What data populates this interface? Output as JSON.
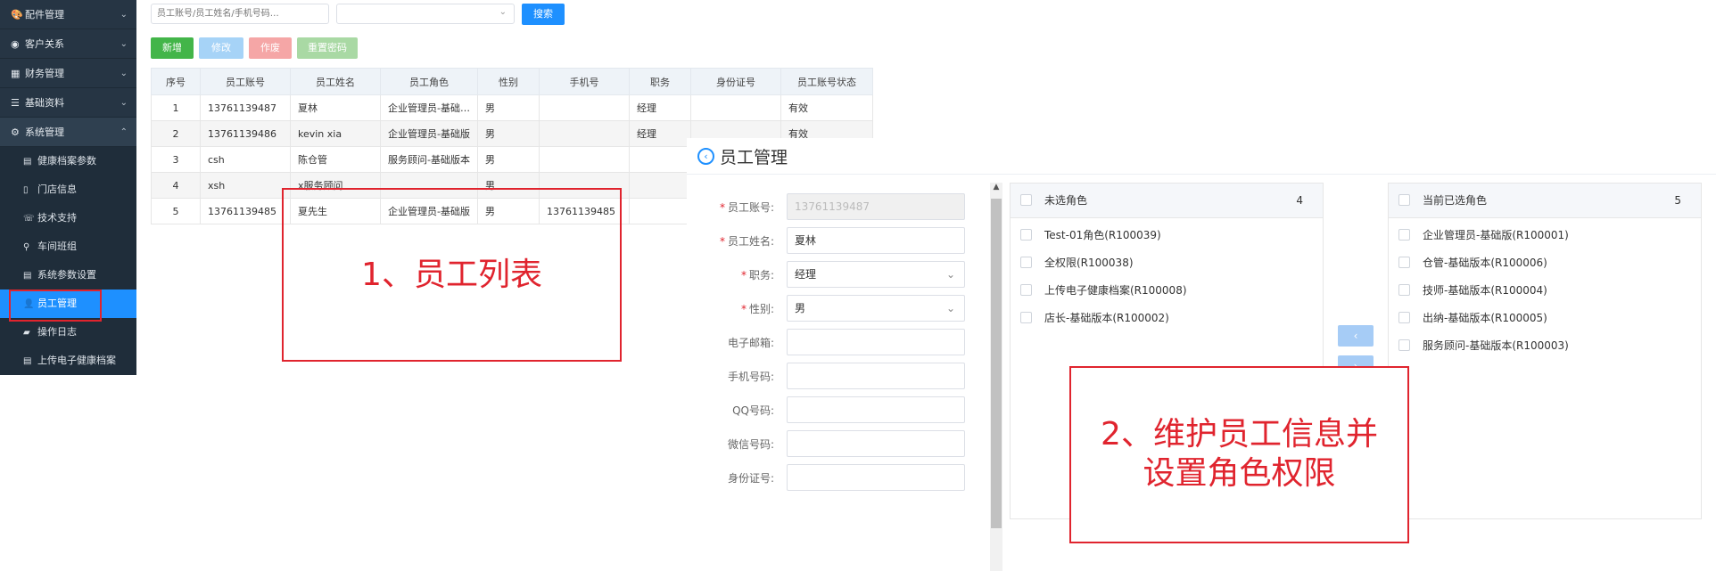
{
  "sidebar": {
    "groups": [
      {
        "label": "配件管理",
        "icon": "palette-icon",
        "glyph": "🎨",
        "chevron": "⌄"
      },
      {
        "label": "客户关系",
        "icon": "user-circle-icon",
        "glyph": "◉",
        "chevron": "⌄"
      },
      {
        "label": "财务管理",
        "icon": "calculator-icon",
        "glyph": "▦",
        "chevron": "⌄"
      },
      {
        "label": "基础资料",
        "icon": "database-icon",
        "glyph": "☰",
        "chevron": "⌄"
      },
      {
        "label": "系统管理",
        "icon": "gears-icon",
        "glyph": "⚙",
        "chevron": "⌃"
      }
    ],
    "sub_items": [
      {
        "label": "健康档案参数",
        "icon": "file-icon",
        "glyph": "▤"
      },
      {
        "label": "门店信息",
        "icon": "file-text-icon",
        "glyph": "▯"
      },
      {
        "label": "技术支持",
        "icon": "phone-icon",
        "glyph": "☏"
      },
      {
        "label": "车间班组",
        "icon": "person-icon",
        "glyph": "⚲"
      },
      {
        "label": "系统参数设置",
        "icon": "file-icon",
        "glyph": "▤"
      },
      {
        "label": "员工管理",
        "icon": "user-plus-icon",
        "glyph": "👤"
      },
      {
        "label": "操作日志",
        "icon": "book-icon",
        "glyph": "▰"
      },
      {
        "label": "上传电子健康档案",
        "icon": "file-icon",
        "glyph": "▤"
      }
    ]
  },
  "list": {
    "search_placeholder": "员工账号/员工姓名/手机号码…",
    "search_button": "搜索",
    "buttons": {
      "add": "新增",
      "edit": "修改",
      "void": "作废",
      "reset": "重置密码"
    },
    "columns": [
      "序号",
      "员工账号",
      "员工姓名",
      "员工角色",
      "性别",
      "手机号",
      "职务",
      "身份证号",
      "员工账号状态"
    ],
    "rows": [
      [
        "1",
        "13761139487",
        "夏林",
        "企业管理员-基础…",
        "男",
        "",
        "经理",
        "",
        "有效"
      ],
      [
        "2",
        "13761139486",
        "kevin xia",
        "企业管理员-基础版",
        "男",
        "",
        "经理",
        "",
        "有效"
      ],
      [
        "3",
        "csh",
        "陈仓管",
        "服务顾问-基础版本",
        "男",
        "",
        "",
        "",
        ""
      ],
      [
        "4",
        "xsh",
        "x服务顾问",
        "",
        "男",
        "",
        "",
        "",
        ""
      ],
      [
        "5",
        "13761139485",
        "夏先生",
        "企业管理员-基础版",
        "男",
        "13761139485",
        "",
        "",
        ""
      ]
    ]
  },
  "annotations": {
    "list": "1、员工列表",
    "edit_line1": "2、维护员工信息并",
    "edit_line2": "设置角色权限"
  },
  "edit": {
    "title": "员工管理",
    "fields": [
      {
        "label": "员工账号:",
        "required": true,
        "value": "13761139487",
        "disabled": true,
        "select": false
      },
      {
        "label": "员工姓名:",
        "required": true,
        "value": "夏林",
        "disabled": false,
        "select": false
      },
      {
        "label": "职务:",
        "required": true,
        "value": "经理",
        "disabled": false,
        "select": true
      },
      {
        "label": "性别:",
        "required": true,
        "value": "男",
        "disabled": false,
        "select": true
      },
      {
        "label": "电子邮箱:",
        "required": false,
        "value": "",
        "disabled": false,
        "select": false
      },
      {
        "label": "手机号码:",
        "required": false,
        "value": "",
        "disabled": false,
        "select": false
      },
      {
        "label": "QQ号码:",
        "required": false,
        "value": "",
        "disabled": false,
        "select": false
      },
      {
        "label": "微信号码:",
        "required": false,
        "value": "",
        "disabled": false,
        "select": false
      },
      {
        "label": "身份证号:",
        "required": false,
        "value": "",
        "disabled": false,
        "select": false
      }
    ],
    "unselected": {
      "title": "未选角色",
      "count": "4",
      "items": [
        "Test-01角色(R100039)",
        "全权限(R100038)",
        "上传电子健康档案(R100008)",
        "店长-基础版本(R100002)"
      ]
    },
    "selected": {
      "title": "当前已选角色",
      "count": "5",
      "items": [
        "企业管理员-基础版(R100001)",
        "仓管-基础版本(R100006)",
        "技师-基础版本(R100004)",
        "出纳-基础版本(R100005)",
        "服务顾问-基础版本(R100003)"
      ]
    },
    "move_left": "‹",
    "move_right": "›"
  },
  "colors": {
    "sidebar_bg": "#263544",
    "accent": "#1e90ff",
    "success": "#43b549",
    "annotation": "#e0242e"
  }
}
